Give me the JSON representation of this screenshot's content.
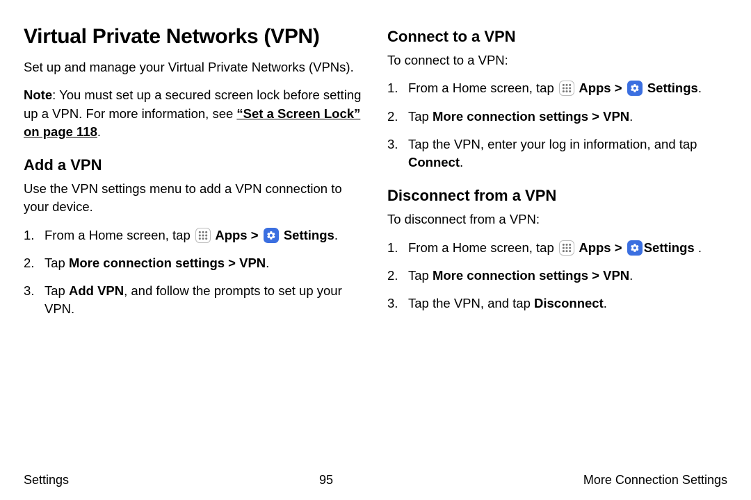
{
  "left": {
    "title": "Virtual Private Networks (VPN)",
    "intro": "Set up and manage your Virtual Private Networks (VPNs).",
    "note_label": "Note",
    "note_text": ": You must set up a secured screen lock before setting up a VPN. For more information, see ",
    "note_link": "“Set a Screen Lock” on page 118",
    "add": {
      "heading": "Add a VPN",
      "desc": "Use the VPN settings menu to add a VPN connection to your device.",
      "s1a": "From a Home screen, tap ",
      "s1_apps": " Apps",
      "s1_chev": " > ",
      "s1_settings": " Settings",
      "s2a": "Tap ",
      "s2b": "More connection settings > VPN",
      "s3a": "Tap ",
      "s3b": "Add VPN",
      "s3c": ", and follow the prompts to set up your VPN."
    }
  },
  "right": {
    "connect": {
      "heading": "Connect to a VPN",
      "desc": "To connect to a VPN:",
      "s1a": "From a Home screen, tap ",
      "s1_apps": " Apps",
      "s1_chev": " > ",
      "s1_settings": " Settings",
      "s2a": "Tap ",
      "s2b": "More connection settings > VPN",
      "s3a": "Tap the VPN, enter your log in information, and tap ",
      "s3b": "Connect"
    },
    "disconnect": {
      "heading": "Disconnect from a VPN",
      "desc": "To disconnect from a VPN:",
      "s1a": "From a Home screen, tap ",
      "s1_apps": " Apps",
      "s1_chev": " > ",
      "s1_settings": "Settings",
      "s2a": "Tap ",
      "s2b": "More connection settings > VPN",
      "s3a": "Tap the VPN, and tap ",
      "s3b": "Disconnect"
    }
  },
  "footer": {
    "left": "Settings",
    "center": "95",
    "right": "More Connection Settings"
  }
}
